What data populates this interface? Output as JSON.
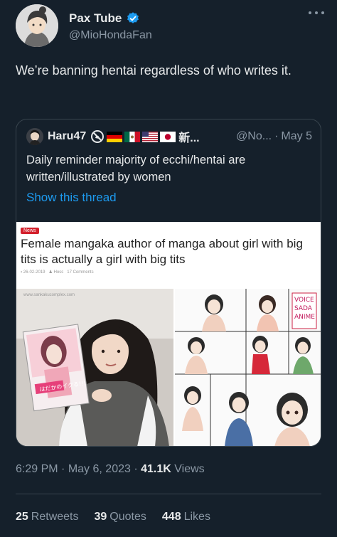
{
  "author": {
    "display_name": "Pax Tube",
    "handle": "@MioHondaFan",
    "avatar_icon": "anime-character-avatar",
    "verified_icon": "verified-badge-icon"
  },
  "tweet": {
    "text": "We’re banning hentai regardless of who writes it."
  },
  "quote": {
    "name": "Haru47",
    "name_suffix": "新...",
    "handle": "@No...",
    "dot": "·",
    "date": "May 5",
    "text": "Daily reminder majority of ecchi/hentai are written/illustrated by women",
    "show_thread": "Show this thread",
    "flags": [
      "no-symbol-icon",
      "germany-flag-icon",
      "mexico-flag-icon",
      "usa-flag-icon",
      "japan-flag-icon"
    ]
  },
  "article": {
    "tag": "News",
    "title": "Female mangaka author of manga about girl with big tits is actually a girl with big tits",
    "date": "26-02-2019",
    "author": "Hoss",
    "comments": "17 Comments",
    "site": "www.sankakucomplex.com",
    "book_title": "はだかのイクる!!!"
  },
  "meta": {
    "time": "6:29 PM",
    "sep1": "·",
    "date": "May 6, 2023",
    "sep2": "·",
    "views_count": "41.1K",
    "views_label": "Views"
  },
  "stats": {
    "retweets_count": "25",
    "retweets_label": "Retweets",
    "quotes_count": "39",
    "quotes_label": "Quotes",
    "likes_count": "448",
    "likes_label": "Likes"
  },
  "colors": {
    "background": "#15202b",
    "text": "#e7e9ea",
    "secondary": "#8b98a5",
    "accent": "#1d9bf0",
    "border": "#38444d"
  }
}
